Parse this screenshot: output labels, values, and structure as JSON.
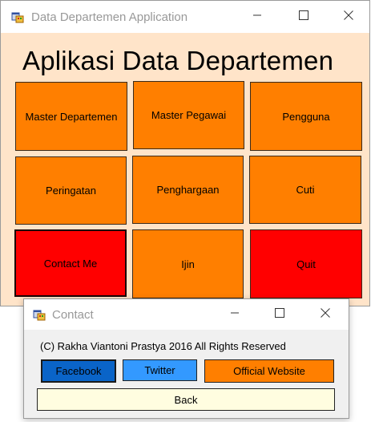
{
  "main_window": {
    "title": "Data Departemen Application",
    "heading": "Aplikasi Data Departemen",
    "client_color": "#ffe4c9",
    "tiles": [
      {
        "label": "Master Departemen",
        "color": "#ff7f00"
      },
      {
        "label": "Master Pegawai",
        "color": "#ff7f00"
      },
      {
        "label": "Pengguna",
        "color": "#ff7f00"
      },
      {
        "label": "Peringatan",
        "color": "#ff7f00"
      },
      {
        "label": "Penghargaan",
        "color": "#ff7f00"
      },
      {
        "label": "Cuti",
        "color": "#ff7f00"
      },
      {
        "label": "Contact Me",
        "color": "#ff0000"
      },
      {
        "label": "Ijin",
        "color": "#ff7f00"
      },
      {
        "label": "Quit",
        "color": "#ff0000"
      }
    ]
  },
  "contact_dialog": {
    "title": "Contact",
    "copyright": "(C) Rakha Viantoni Prastya 2016 All Rights Reserved",
    "client_color": "#f0f0f0",
    "buttons": {
      "facebook": {
        "label": "Facebook",
        "color": "#0a64c8"
      },
      "twitter": {
        "label": "Twitter",
        "color": "#3399ff"
      },
      "website": {
        "label": "Official Website",
        "color": "#ff7f00"
      },
      "back": {
        "label": "Back",
        "color": "#fffde0"
      }
    }
  },
  "icons": {
    "app": "app-window-icon",
    "minimize": "minimize-icon",
    "maximize": "maximize-icon",
    "close": "close-icon"
  }
}
